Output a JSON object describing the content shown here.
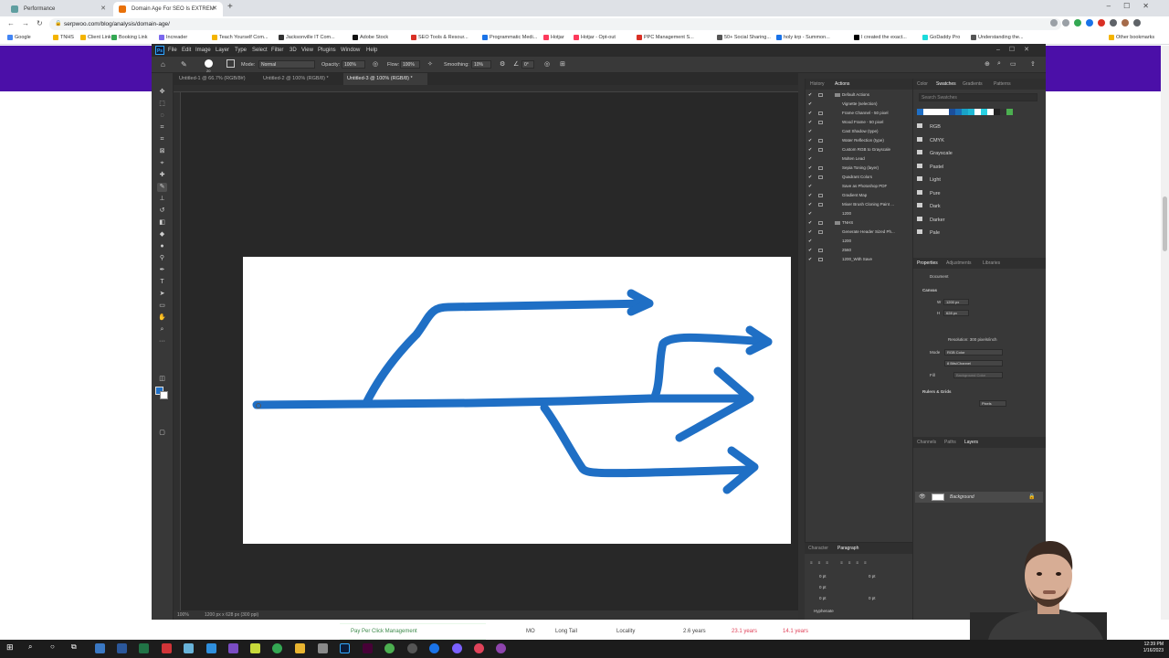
{
  "browser": {
    "tabs": [
      {
        "label": "Performance",
        "fav_color": "#5f9ea0"
      },
      {
        "label": "Domain Age For SEO Is EXTREM",
        "fav_color": "#e8710a"
      }
    ],
    "new_tab": "+",
    "url": "serpwoo.com/blog/analysis/domain-age/",
    "bookmarks": [
      {
        "label": "Google",
        "color": "#4285f4"
      },
      {
        "label": "TNHS",
        "color": "#f4b400"
      },
      {
        "label": "Client Links",
        "color": "#f4b400"
      },
      {
        "label": "Booking Link",
        "color": "#34a853"
      },
      {
        "label": "Increader",
        "color": "#7b68ee"
      },
      {
        "label": "Teach Yourself Com...",
        "color": "#f4b400"
      },
      {
        "label": "Jacksonville IT Com...",
        "color": "#333333"
      },
      {
        "label": "Adobe Stock",
        "color": "#111111"
      },
      {
        "label": "SEO Tools & Resour...",
        "color": "#d93025"
      },
      {
        "label": "Programmatic Medi...",
        "color": "#1a73e8"
      },
      {
        "label": "Hotjar",
        "color": "#fd3a5c"
      },
      {
        "label": "Hotjar - Opt-out",
        "color": "#fd3a5c"
      },
      {
        "label": "PPC Management S...",
        "color": "#d93025"
      },
      {
        "label": "50+ Social Sharing...",
        "color": "#555555"
      },
      {
        "label": "holy krp - Summon...",
        "color": "#1a73e8"
      },
      {
        "label": "I created the exact...",
        "color": "#000000"
      },
      {
        "label": "GoDaddy Pro",
        "color": "#1bdbdb"
      },
      {
        "label": "Understanding the...",
        "color": "#555555"
      }
    ],
    "other_bookmarks": "Other bookmarks"
  },
  "photoshop": {
    "logo": "Ps",
    "menu": [
      "File",
      "Edit",
      "Image",
      "Layer",
      "Type",
      "Select",
      "Filter",
      "3D",
      "View",
      "Plugins",
      "Window",
      "Help"
    ],
    "options": {
      "mode_label": "Mode:",
      "mode_value": "Normal",
      "opacity_label": "Opacity:",
      "opacity_value": "100%",
      "flow_label": "Flow:",
      "flow_value": "100%",
      "smoothing_label": "Smoothing:",
      "smoothing_value": "10%",
      "angle_value": "0°",
      "brush_size": "20"
    },
    "doc_tabs": [
      "Untitled-1 @ 66.7% (RGB/8#)",
      "Untitled-2 @ 100% (RGB/8) *",
      "Untitled-3 @ 100% (RGB/8) *"
    ],
    "status": {
      "zoom": "100%",
      "doc_info": "1200 px x 628 px (300 ppi)"
    },
    "panel_mid_tabs": [
      "History",
      "Actions"
    ],
    "actions": [
      {
        "label": "Default Actions",
        "type": "set"
      },
      {
        "label": "Vignette (selection)",
        "type": "action"
      },
      {
        "label": "Frame Channel - 50 pixel",
        "type": "action"
      },
      {
        "label": "Wood Frame - 50 pixel",
        "type": "action"
      },
      {
        "label": "Cast Shadow (type)",
        "type": "action"
      },
      {
        "label": "Water Reflection (type)",
        "type": "action"
      },
      {
        "label": "Custom RGB to Grayscale",
        "type": "action"
      },
      {
        "label": "Molten Lead",
        "type": "action"
      },
      {
        "label": "Sepia Toning (layer)",
        "type": "action"
      },
      {
        "label": "Quadrant Colors",
        "type": "action"
      },
      {
        "label": "Save as Photoshop PDF",
        "type": "action"
      },
      {
        "label": "Gradient Map",
        "type": "action"
      },
      {
        "label": "Mixer Brush Cloning Paint ...",
        "type": "action"
      },
      {
        "label": "1200",
        "type": "action"
      },
      {
        "label": "TNHS",
        "type": "set"
      },
      {
        "label": "Generate Header Sized Ph...",
        "type": "action"
      },
      {
        "label": "1200",
        "type": "action"
      },
      {
        "label": "2560",
        "type": "action"
      },
      {
        "label": "1200_With Save",
        "type": "action"
      }
    ],
    "swatch_tabs": [
      "Color",
      "Swatches",
      "Gradients",
      "Patterns"
    ],
    "swatch_search": "Search Swatches",
    "swatch_colors": [
      "#1f6fc5",
      "#ffffff",
      "#ffffff",
      "#ffffff",
      "#ffffff",
      "#1b4f9c",
      "#1b6fb8",
      "#18a3c8",
      "#1fb8d4",
      "#ffffff",
      "#2ad1e3",
      "#ffffff",
      "#222222",
      "#333333",
      "#4caf50"
    ],
    "swatch_groups": [
      "RGB",
      "CMYK",
      "Grayscale",
      "Pastel",
      "Light",
      "Pure",
      "Dark",
      "Darker",
      "Pale"
    ],
    "props_tabs": [
      "Properties",
      "Adjustments",
      "Libraries"
    ],
    "props": {
      "document": "Document",
      "canvas": "Canvas",
      "w": "1200 px",
      "h": "628 px",
      "resolution": "Resolution: 300 pixels/inch",
      "mode_label": "Mode",
      "mode": "RGB Color",
      "bits": "8 Bits/Channel",
      "fill_label": "Fill",
      "fill": "Background Color",
      "rulers": "Rulers & Grids",
      "units": "Pixels"
    },
    "layers_tabs": [
      "Channels",
      "Paths",
      "Layers"
    ],
    "layer_name": "Background",
    "para_tabs": [
      "Character",
      "Paragraph"
    ],
    "para_values": [
      "0 pt",
      "0 pt",
      "0 pt",
      "0 pt",
      "0 pt"
    ],
    "hyphenate": "Hyphenate"
  },
  "bottom_strip": {
    "keyword": "Pay Per Click Management",
    "state": "MO",
    "tail": "Long Tail",
    "intent": "Locality",
    "age1": "2.6 years",
    "age2": "23.1 years",
    "age3": "14.1 years"
  },
  "taskbar": {
    "time": "12:39 PM",
    "date": "1/16/2023"
  }
}
